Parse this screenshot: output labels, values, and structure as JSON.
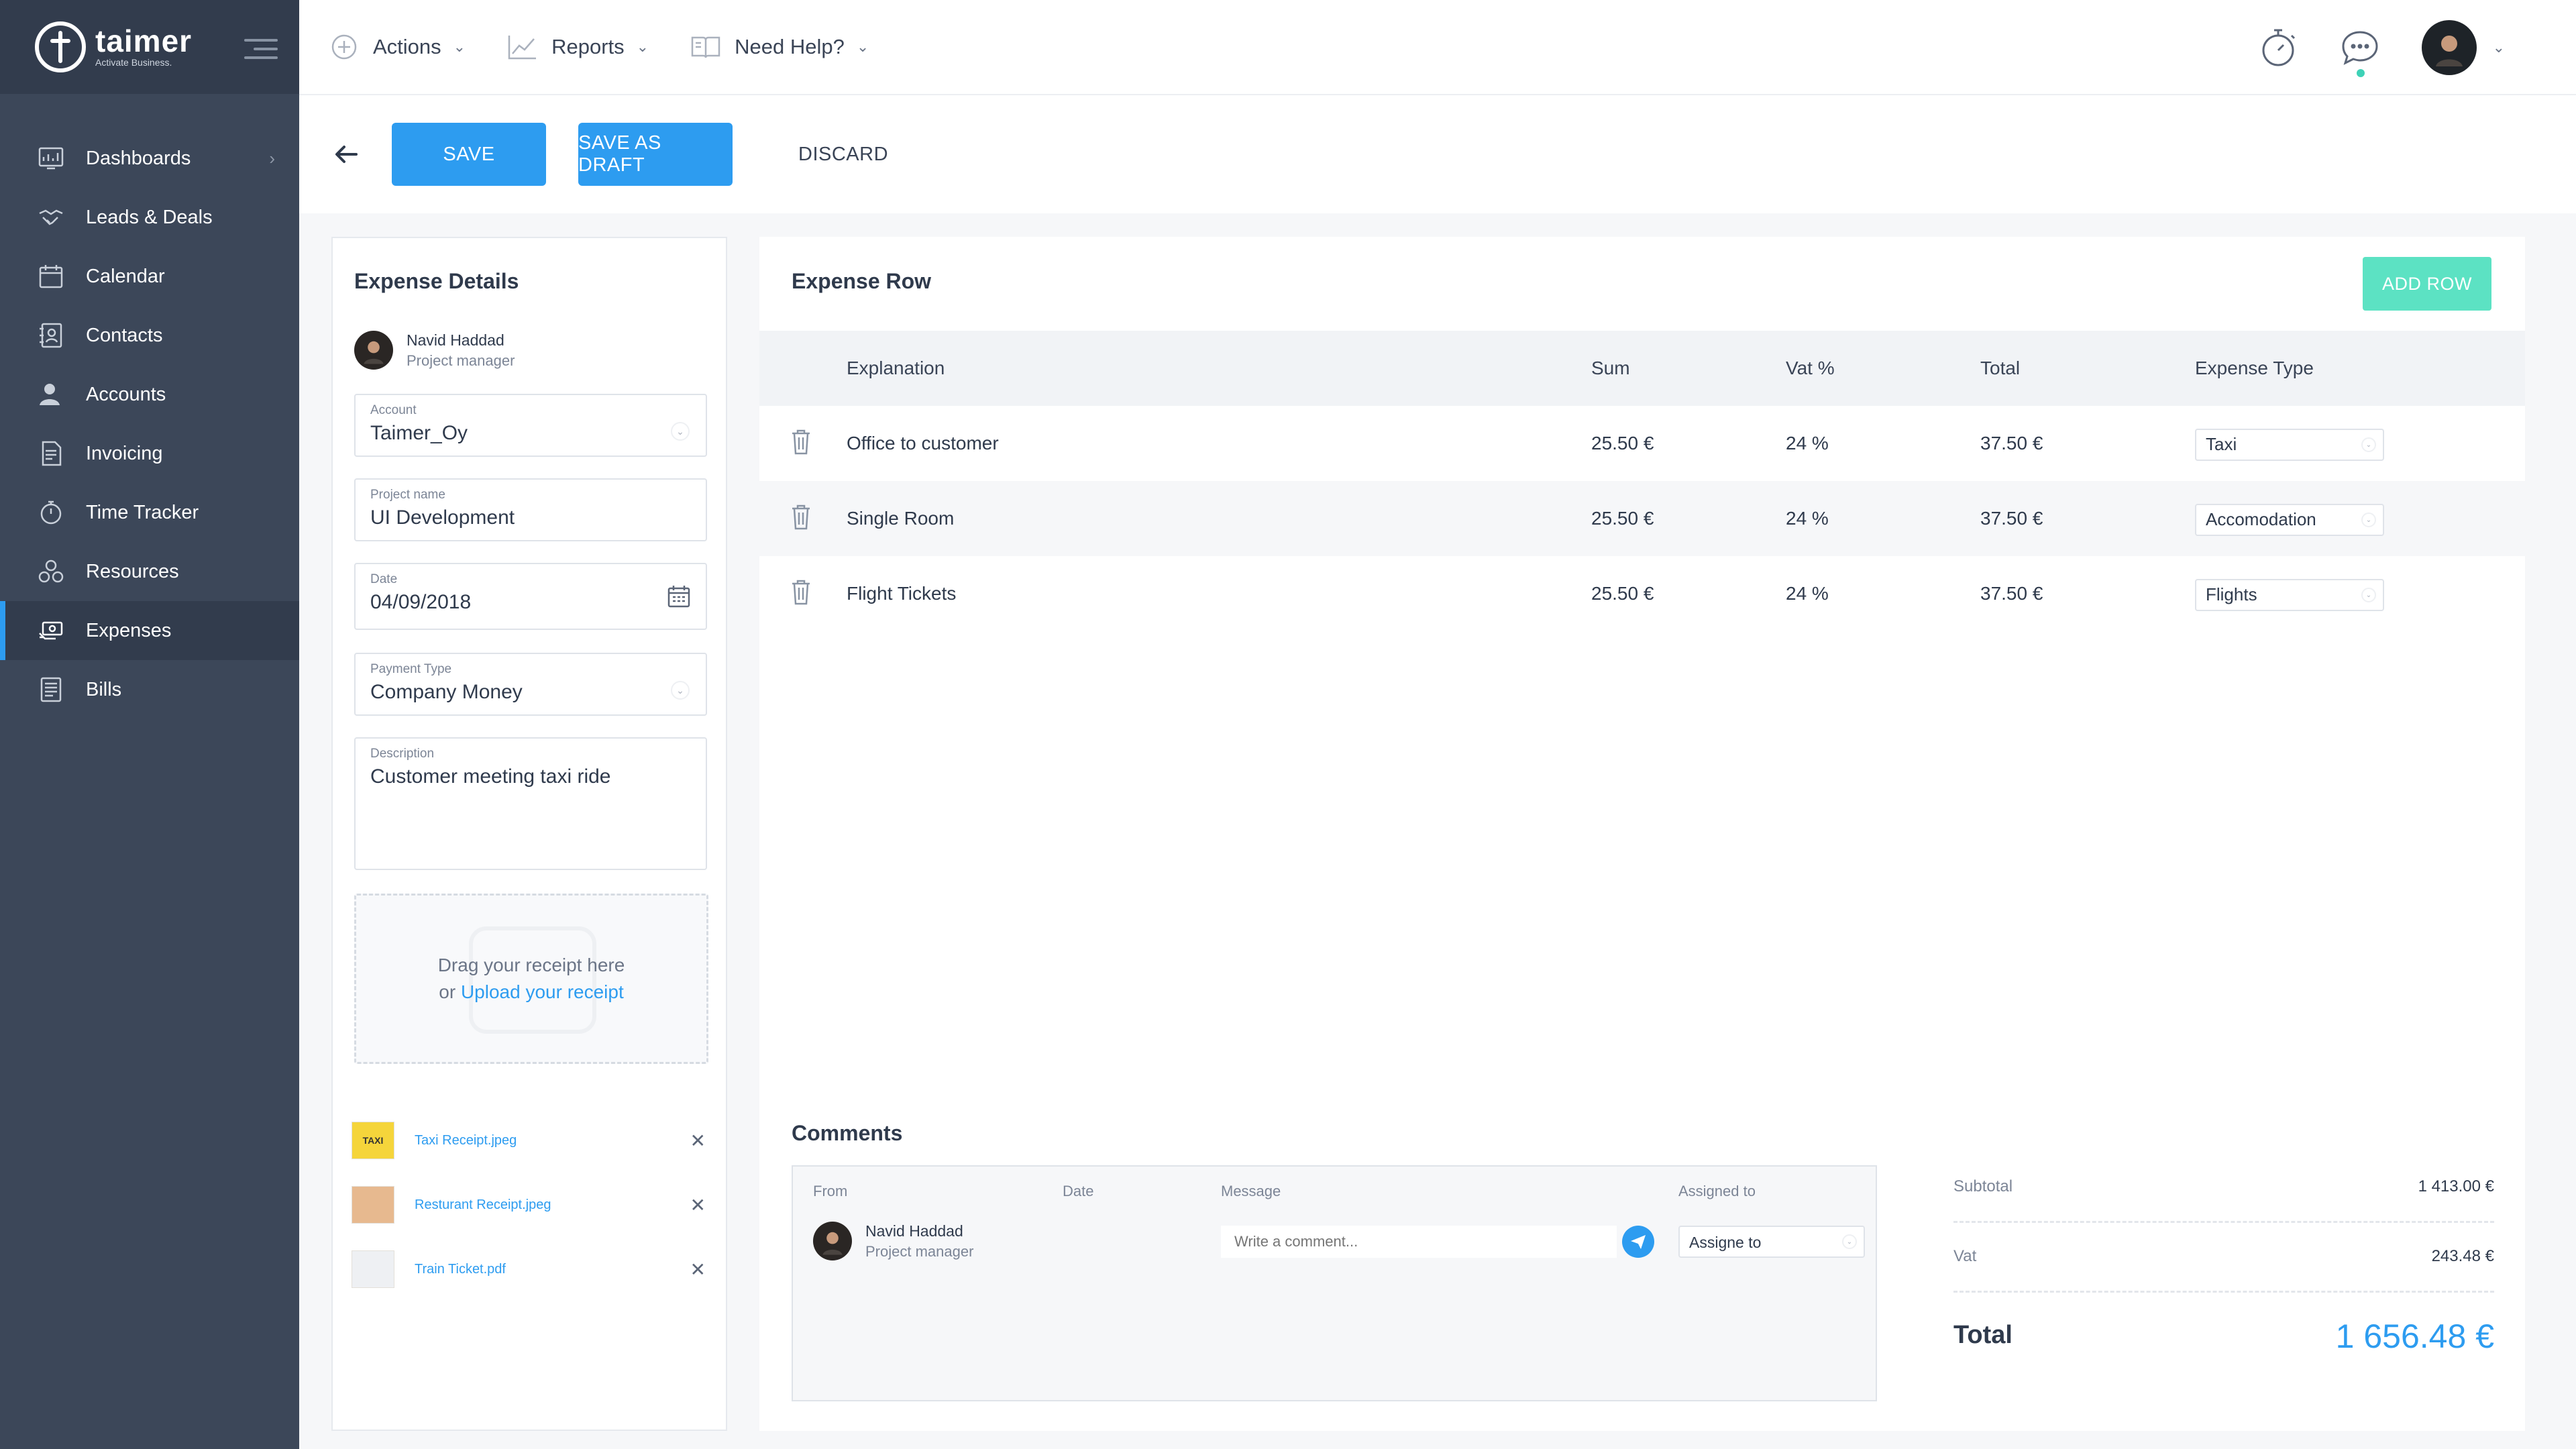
{
  "brand": {
    "name": "taimer",
    "tagline": "Activate Business."
  },
  "sidebar": {
    "items": [
      {
        "label": "Dashboards",
        "icon": "dashboard-icon",
        "chevron": "›"
      },
      {
        "label": "Leads & Deals",
        "icon": "handshake-icon"
      },
      {
        "label": "Calendar",
        "icon": "calendar-icon"
      },
      {
        "label": "Contacts",
        "icon": "contacts-icon"
      },
      {
        "label": "Accounts",
        "icon": "accounts-icon"
      },
      {
        "label": "Invoicing",
        "icon": "invoice-icon"
      },
      {
        "label": "Time Tracker",
        "icon": "stopwatch-icon"
      },
      {
        "label": "Resources",
        "icon": "resources-icon"
      },
      {
        "label": "Expenses",
        "icon": "expenses-icon",
        "active": true
      },
      {
        "label": "Bills",
        "icon": "bills-icon"
      }
    ]
  },
  "topbar": {
    "menu": [
      {
        "label": "Actions",
        "icon": "plus-circle-icon"
      },
      {
        "label": "Reports",
        "icon": "chart-icon"
      },
      {
        "label": "Need Help?",
        "icon": "book-icon"
      }
    ]
  },
  "toolbar": {
    "save_label": "SAVE",
    "draft_label": "SAVE AS DRAFT",
    "discard_label": "DISCARD"
  },
  "details": {
    "title": "Expense Details",
    "user": {
      "name": "Navid Haddad",
      "role": "Project manager"
    },
    "account": {
      "label": "Account",
      "value": "Taimer_Oy"
    },
    "project": {
      "label": "Project name",
      "value": "UI Development"
    },
    "date": {
      "label": "Date",
      "value": "04/09/2018"
    },
    "payment": {
      "label": "Payment Type",
      "value": "Company Money"
    },
    "description": {
      "label": "Description",
      "value": "Customer meeting taxi ride"
    },
    "dropzone": {
      "line1": "Drag your receipt here",
      "or": "or",
      "upload": "Upload",
      "receipt": "your receipt"
    },
    "files": [
      {
        "name": "Taxi Receipt.jpeg",
        "thumb": "TAXI"
      },
      {
        "name": "Resturant Receipt.jpeg",
        "thumb": ""
      },
      {
        "name": "Train Ticket.pdf",
        "thumb": ""
      }
    ]
  },
  "expense": {
    "title": "Expense Row",
    "add_row_label": "ADD ROW",
    "columns": {
      "explanation": "Explanation",
      "sum": "Sum",
      "vat": "Vat %",
      "total": "Total",
      "type": "Expense Type"
    },
    "rows": [
      {
        "explanation": "Office to customer",
        "sum": "25.50 €",
        "vat": "24 %",
        "total": "37.50 €",
        "type": "Taxi"
      },
      {
        "explanation": "Single Room",
        "sum": "25.50 €",
        "vat": "24 %",
        "total": "37.50 €",
        "type": "Accomodation"
      },
      {
        "explanation": "Flight Tickets",
        "sum": "25.50 €",
        "vat": "24 %",
        "total": "37.50 €",
        "type": "Flights"
      }
    ]
  },
  "comments": {
    "title": "Comments",
    "columns": {
      "from": "From",
      "date": "Date",
      "message": "Message",
      "assigned": "Assigned to"
    },
    "user": {
      "name": "Navid Haddad",
      "role": "Project manager"
    },
    "placeholder": "Write a comment...",
    "assign_value": "Assigne to"
  },
  "totals": {
    "subtotal_label": "Subtotal",
    "subtotal": "1 413.00 €",
    "vat_label": "Vat",
    "vat": "243.48 €",
    "total_label": "Total",
    "total": "1 656.48 €"
  },
  "colors": {
    "accent": "#2d9cf0",
    "sidebar": "#3c4759",
    "add_row": "#5ce2c3"
  }
}
